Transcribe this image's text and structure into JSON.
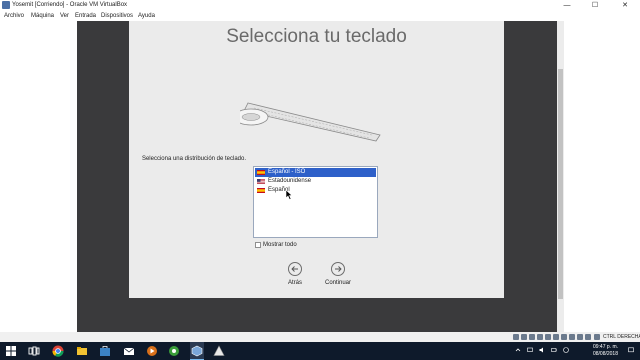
{
  "window": {
    "title": "Yosemit [Corriendo] - Oracle VM VirtualBox",
    "min_glyph": "—",
    "max_glyph": "☐",
    "close_glyph": "✕"
  },
  "menu": [
    "Archivo",
    "Máquina",
    "Ver",
    "Entrada",
    "Dispositivos",
    "Ayuda"
  ],
  "installer": {
    "title": "Selecciona tu teclado",
    "prompt": "Selecciona una distribución de teclado.",
    "layouts": [
      {
        "label": "Español - ISO",
        "flag": "spain-flag-icon",
        "selected": true
      },
      {
        "label": "Estadounidense",
        "flag": "us-flag-icon",
        "selected": false
      },
      {
        "label": "Español",
        "flag": "spain-flag-icon",
        "selected": false
      }
    ],
    "show_all_label": "Mostrar todo",
    "show_all_checked": false,
    "back_label": "Atrás",
    "continue_label": "Continuar"
  },
  "statusbar": {
    "host_key": "CTRL DERECHA"
  },
  "taskbar": {
    "time": "09:47 p. m.",
    "date": "08/08/2018"
  },
  "colors": {
    "selection": "#2e60c9",
    "panel": "#ebebeb",
    "vm_background": "#3a3a3c",
    "taskbar": "#0e1a2b"
  }
}
